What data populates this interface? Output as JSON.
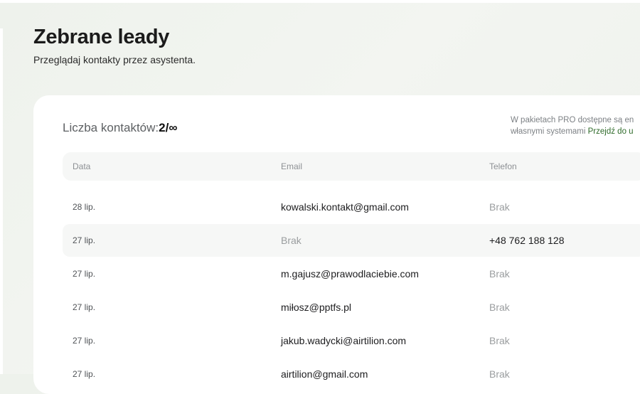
{
  "page": {
    "title": "Zebrane leady",
    "subtitle": "Przeglądaj kontakty przez asystenta."
  },
  "summary": {
    "count_label": "Liczba kontaktów:",
    "count_value": "2/∞",
    "promo_line1": "W pakietach PRO dostępne są en",
    "promo_line2_prefix": "własnymi systemami ",
    "promo_link": "Przejdź do u"
  },
  "table": {
    "columns": [
      "Data",
      "Email",
      "Telefon"
    ],
    "rows": [
      {
        "date": "28 lip.",
        "email": "kowalski.kontakt@gmail.com",
        "phone": "Brak"
      },
      {
        "date": "27 lip.",
        "email": "Brak",
        "phone": "+48 762 188 128"
      },
      {
        "date": "27 lip.",
        "email": "m.gajusz@prawodlaciebie.com",
        "phone": "Brak"
      },
      {
        "date": "27 lip.",
        "email": "miłosz@pptfs.pl",
        "phone": "Brak"
      },
      {
        "date": "27 lip.",
        "email": "jakub.wadycki@airtilion.com",
        "phone": "Brak"
      },
      {
        "date": "27 lip.",
        "email": "airtilion@gmail.com",
        "phone": "Brak"
      }
    ]
  },
  "colors": {
    "background": "#eef2ec",
    "card": "#ffffff",
    "accent_link": "#2f6b2a",
    "row_alt": "#f6f7f6"
  }
}
